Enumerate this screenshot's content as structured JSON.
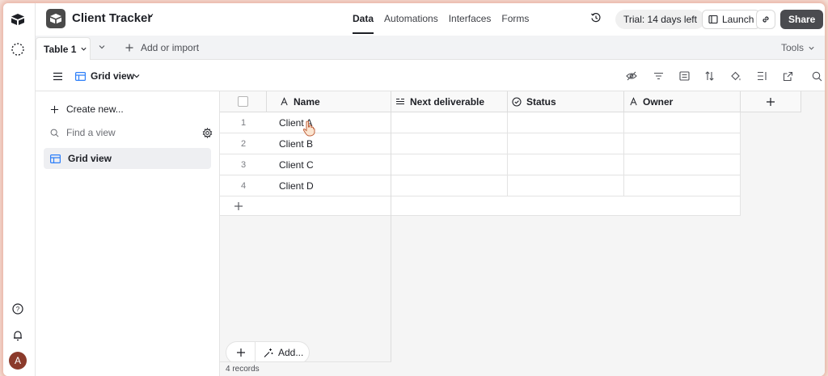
{
  "header": {
    "base_name": "Client Tracker",
    "nav": [
      "Data",
      "Automations",
      "Interfaces",
      "Forms"
    ],
    "trial": "Trial: 14 days left",
    "launch": "Launch",
    "share": "Share"
  },
  "tabs": {
    "active": "Table 1",
    "add_or_import": "Add or import",
    "tools": "Tools"
  },
  "view": {
    "name": "Grid view"
  },
  "sidebar": {
    "create_new": "Create new...",
    "find_placeholder": "Find a view",
    "views": [
      "Grid view"
    ]
  },
  "grid": {
    "columns": [
      "Name",
      "Next deliverable",
      "Status",
      "Owner"
    ],
    "rows": [
      {
        "num": "1",
        "name": "Client A"
      },
      {
        "num": "2",
        "name": "Client B"
      },
      {
        "num": "3",
        "name": "Client C"
      },
      {
        "num": "4",
        "name": "Client D"
      }
    ],
    "add_label": "Add...",
    "record_count": "4 records"
  },
  "user": {
    "avatar_initial": "A"
  },
  "icons": {
    "rail": [
      "base-logo-icon",
      "workspace-icon",
      "help-icon",
      "notifications-icon"
    ],
    "viewbar": [
      "hide-fields-icon",
      "filter-icon",
      "group-icon",
      "sort-icon",
      "color-icon",
      "row-height-icon",
      "share-view-icon",
      "search-icon"
    ]
  },
  "colors": {
    "share_bg": "#4a4b4f",
    "grid_icon": "#2d7ff9",
    "avatar": "#8b3a2b"
  }
}
